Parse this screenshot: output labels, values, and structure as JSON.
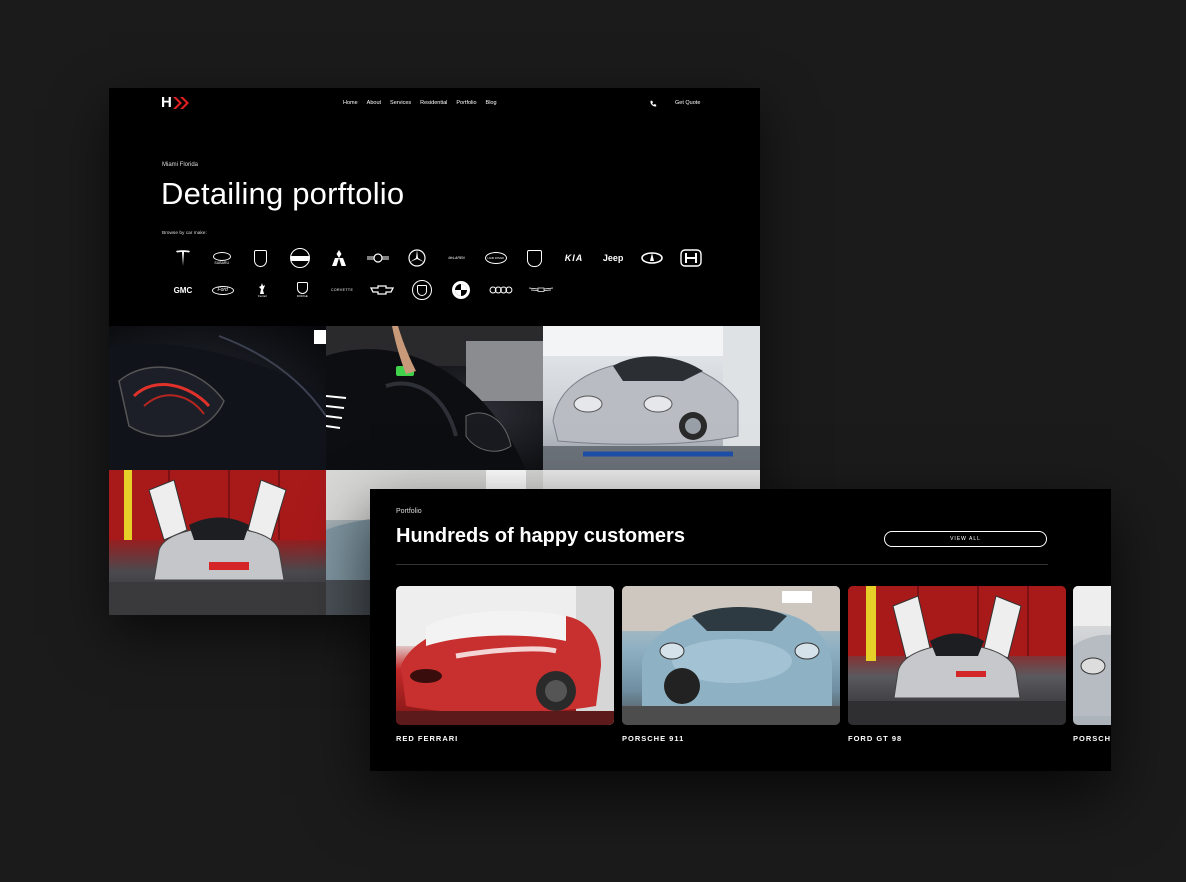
{
  "site": {
    "logo_letter": "H",
    "nav": [
      "Home",
      "About",
      "Services",
      "Residential",
      "Portfolio",
      "Blog"
    ],
    "cta": "Get Quote"
  },
  "hero": {
    "eyebrow": "Miami Florida",
    "title": "Detailing porftolio",
    "browse_label": "Browse by car make:"
  },
  "brands": {
    "row1": [
      "Tesla",
      "Subaru",
      "Porsche",
      "Nissan",
      "Mitsubishi",
      "Mini",
      "Mercedes",
      "McLaren",
      "Land Rover",
      "Lamborghini",
      "Kia",
      "Jeep",
      "Infiniti",
      "Honda"
    ],
    "row2": [
      "GMC",
      "Ford",
      "Ferrari",
      "Dodge",
      "Corvette",
      "Chevrolet",
      "Cadillac",
      "BMW",
      "Audi",
      "Aston Martin"
    ],
    "text_marks": {
      "subaru": "SUBARU",
      "kia": "KIA",
      "jeep": "Jeep",
      "gmc": "GMC",
      "ford": "Ford",
      "dodge": "DODGE",
      "corvette": "CORVETTE",
      "mclaren": "McLAREN",
      "landrover": "LAND ROVER",
      "ferrari": "Ferrari"
    }
  },
  "portfolio": {
    "eyebrow": "Portfolio",
    "title": "Hundreds of happy customers",
    "view_all": "VIEW ALL",
    "cards": [
      {
        "label": "RED FERRARI"
      },
      {
        "label": "PORSCHE 911"
      },
      {
        "label": "FORD GT 98"
      },
      {
        "label": "PORSCHE"
      }
    ]
  },
  "colors": {
    "background": "#1b1b1b",
    "panel": "#000000",
    "accent_red": "#e02020",
    "text": "#ffffff"
  }
}
